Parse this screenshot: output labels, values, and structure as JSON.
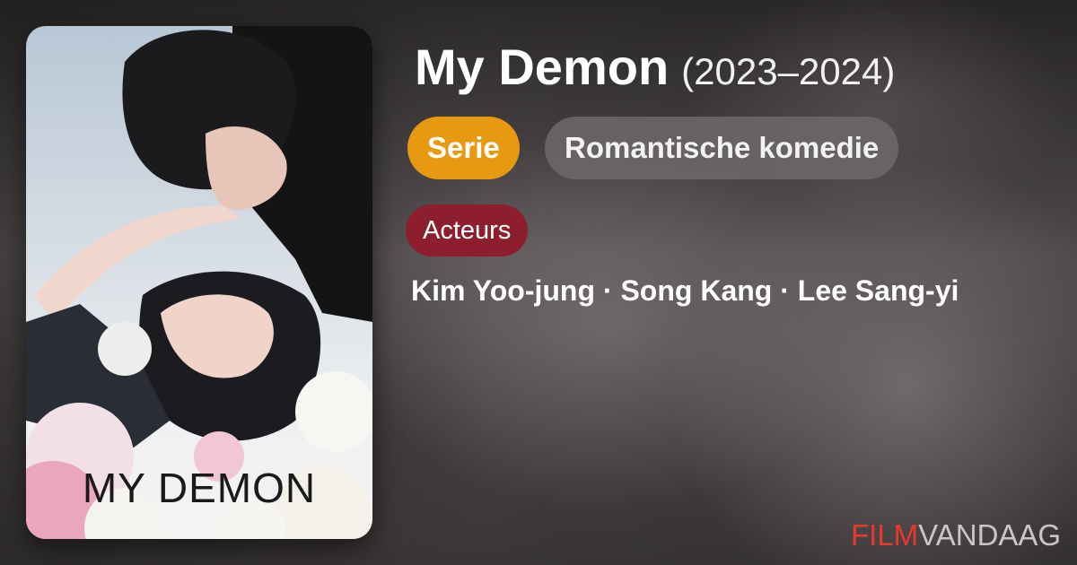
{
  "show": {
    "title": "My Demon",
    "years": "(2023–2024)",
    "type_label": "Serie",
    "genre_label": "Romantische komedie",
    "actors_label": "Acteurs",
    "actors": "Kim Yoo-jung · Song Kang · Lee Sang-yi"
  },
  "poster": {
    "title_text": "MY DEMON"
  },
  "brand": {
    "part1": "FILM",
    "part2": "VANDAAG"
  },
  "colors": {
    "type_pill": "#e79a0f",
    "genre_pill": "#6e6869",
    "actors_pill": "#8c1e2e",
    "brand_red": "#e7392e"
  }
}
